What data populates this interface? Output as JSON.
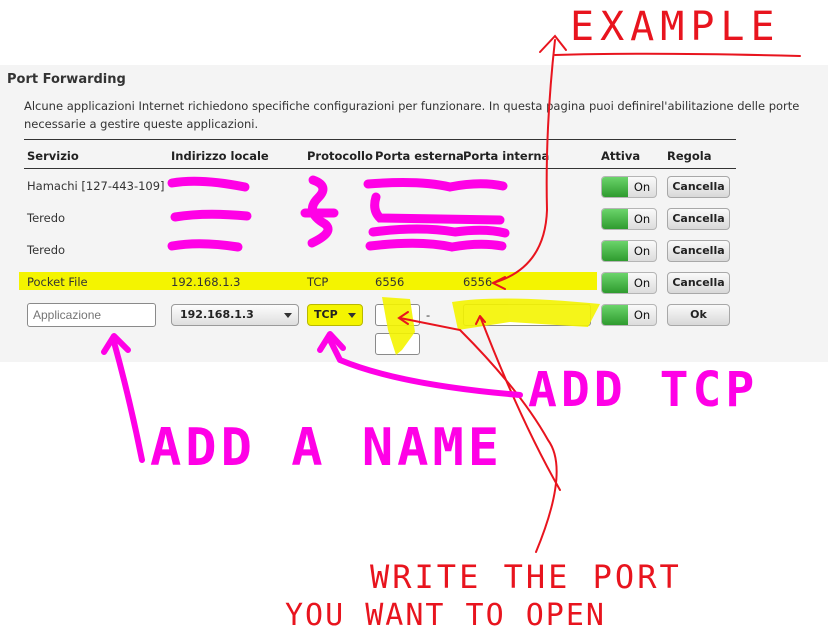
{
  "page": {
    "title": "Port Forwarding",
    "description": "Alcune applicazioni Internet richiedono specifiche configurazioni per funzionare. In questa pagina puoi definirel'abilitazione delle porte necessarie a gestire queste applicazioni."
  },
  "table": {
    "headers": [
      "Servizio",
      "Indirizzo locale",
      "Protocollo",
      "Porta esterna",
      "Porta interna",
      "Attiva",
      "Regola"
    ],
    "rows": [
      {
        "service": "Hamachi [127-443-109]",
        "address": "",
        "protocol": "",
        "external": "",
        "internal": "",
        "active": "On",
        "action": "Cancella",
        "redacted": true
      },
      {
        "service": "Teredo",
        "address": "",
        "protocol": "",
        "external": "",
        "internal": "",
        "active": "On",
        "action": "Cancella",
        "redacted": true
      },
      {
        "service": "Teredo",
        "address": "",
        "protocol": "",
        "external": "",
        "internal": "",
        "active": "On",
        "action": "Cancella",
        "redacted": true
      },
      {
        "service": "Pocket File",
        "address": "192.168.1.3",
        "protocol": "TCP",
        "external": "6556",
        "internal": "6556",
        "active": "On",
        "action": "Cancella",
        "highlighted": true
      }
    ],
    "new_entry": {
      "name_placeholder": "Applicazione",
      "address_selected": "192.168.1.3",
      "protocol_selected": "TCP",
      "external_from": "",
      "external_to": "",
      "range_separator": "-",
      "internal": "",
      "active": "On",
      "confirm": "Ok"
    }
  },
  "annotations": {
    "example": "EXAMPLE",
    "add_name": "ADD A NAME",
    "add_tcp": "ADD TCP",
    "write_port_line1": "WRITE THE PORT",
    "write_port_line2": "YOU WANT TO OPEN"
  },
  "colors": {
    "marker_magenta": "#ff00e6",
    "marker_red": "#e8141e",
    "marker_yellow": "#f4f400",
    "toggle_green": "#2e9b2e"
  }
}
